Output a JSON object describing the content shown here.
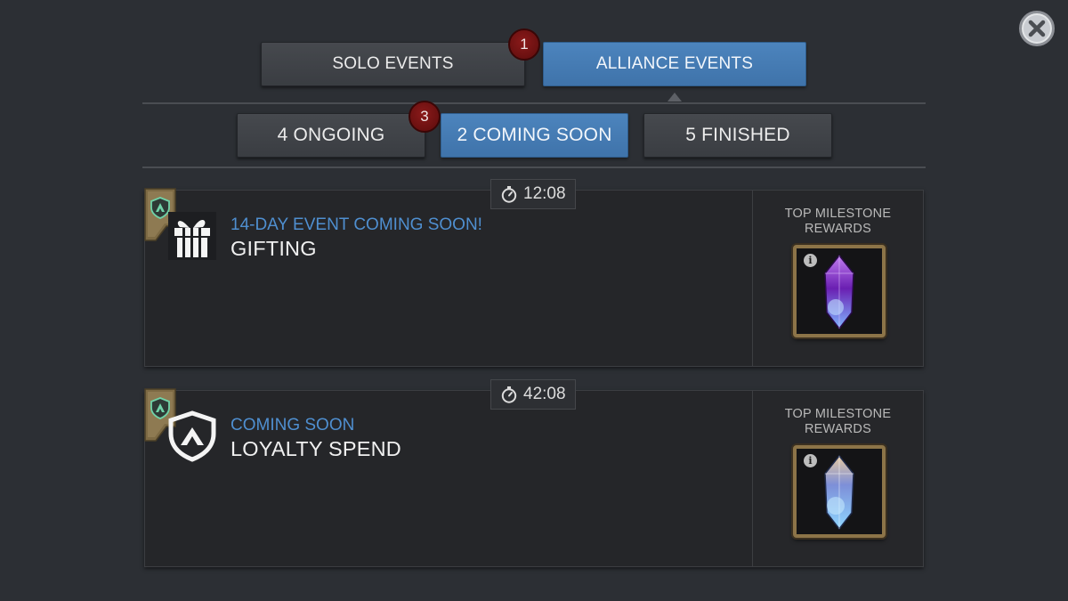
{
  "close": {
    "icon": "close-icon"
  },
  "top_tabs": [
    {
      "label": "SOLO EVENTS",
      "active": false
    },
    {
      "label": "ALLIANCE EVENTS",
      "active": true
    }
  ],
  "top_badge": "1",
  "sub_tabs": [
    {
      "label": "4 ONGOING",
      "active": false
    },
    {
      "label": "2 COMING SOON",
      "active": true
    },
    {
      "label": "5 FINISHED",
      "active": false
    }
  ],
  "sub_badge": "3",
  "events": [
    {
      "timer": "12:08",
      "subtitle": "14-DAY EVENT COMING SOON!",
      "title": "GIFTING",
      "icon": "gift-icon",
      "rewards_label": "TOP MILESTONE REWARDS",
      "reward_icon": "crystal-icon",
      "reward_color": "#8a3fd1"
    },
    {
      "timer": "42:08",
      "subtitle": "COMING SOON",
      "title": "LOYALTY SPEND",
      "icon": "alliance-shield-icon",
      "rewards_label": "TOP MILESTONE REWARDS",
      "reward_icon": "crystal-icon",
      "reward_color": "#6a8fe0"
    }
  ],
  "colors": {
    "accent_blue": "#4a82bc",
    "subtitle_blue": "#4f8fd0",
    "badge_red": "#7a1212"
  }
}
